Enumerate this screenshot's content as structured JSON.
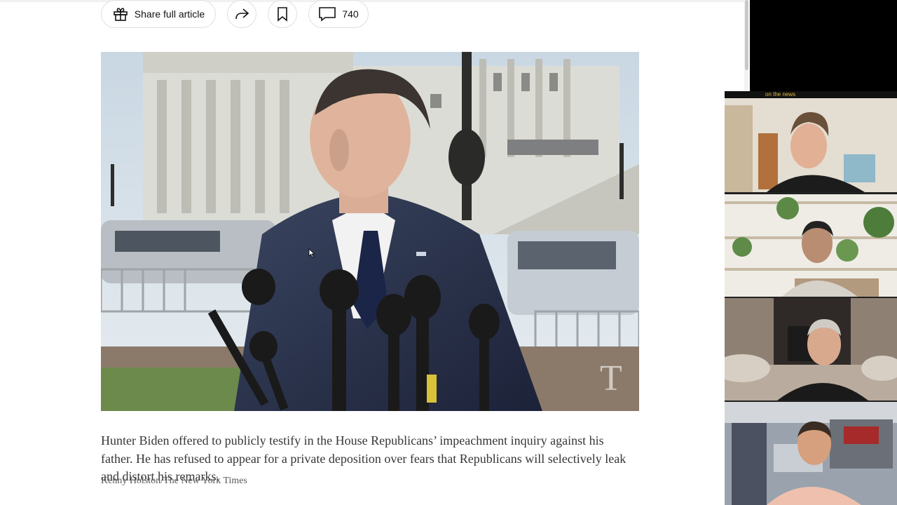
{
  "toolbar": {
    "share_label": "Share full article",
    "comment_count": "740",
    "icons": [
      "gift-icon",
      "share-arrow-icon",
      "bookmark-icon",
      "comment-icon"
    ]
  },
  "photo": {
    "description_alt": "Hunter Biden at microphones outside the U.S. Capitol",
    "watermark": "T"
  },
  "caption": {
    "text": "Hunter Biden offered to publicly testify in the House Republicans’ impeachment inquiry against his father. He has refused to appear for a private deposition over fears that Republicans will selectively leak and distort his remarks.",
    "credit": "Kenny Holston/The New York Times"
  },
  "video_panel": {
    "participants": [
      "participant-1",
      "participant-2",
      "participant-3",
      "participant-4"
    ],
    "top_banner_text": "on the news"
  },
  "colors": {
    "text_primary": "#121212",
    "caption_text": "#363636",
    "credit_text": "#5a5a5a",
    "pill_border": "#dfdfdf"
  }
}
